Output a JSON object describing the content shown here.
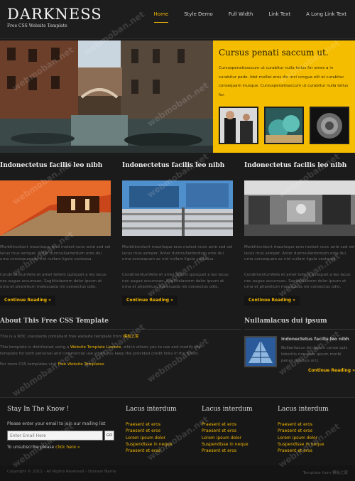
{
  "header": {
    "logo": "DARKNESS",
    "tagline": "Free CSS Website Template",
    "nav": [
      "Home",
      "Style Demo",
      "Full Width",
      "Link Text",
      "A Long Link Text"
    ]
  },
  "hero": {
    "title": "Cursus penati saccum ut.",
    "text": "Cursuspenatisaccum ut curabitur nulla tellus for ames a in curabitur pede. Idet molliei eros dio orci congue elit et curabitur consequam inusque. Cursuspenatisaccum ut curabitur nulla tellus for."
  },
  "columns": [
    {
      "title": "Indonectetus facilis leo nibh",
      "p1": "Morbitincidunt maurisque eros molest nunc ante sed vel lacus mus semper. Anter dumnullanterdum eros dui urna consequam ac nisl nullam ligula vestassa.",
      "p2": "Condimentumfelis et amet tellent quisquet a leo lacus nec augue accumsan. Sagittislaorem dolor ipsum at urna et pharetium malesuada nis consectus odio.",
      "button": "Continue Reading »"
    },
    {
      "title": "Indonectetus facilis leo nibh",
      "p1": "Morbitincidunt maurisque eros molest nunc ante sed vel lacus mus semper. Anter dumnullanterdum eros dui urna consequam ac nisl nullam ligula vestassa.",
      "p2": "Condimentumfelis et amet tellent quisquet a leo lacus nec augue accumsan. Sagittislaorem dolor ipsum at urna et pharetium malesuada nis consectus odio.",
      "button": "Continue Reading »"
    },
    {
      "title": "Indonectetus facilis leo nibh",
      "p1": "Morbitincidunt maurisque eros molest nunc ante sed vel lacus mus semper. Anter dumnullanterdum eros dui urna consequam ac nisl nullam ligula vestassa.",
      "p2": "Condimentumfelis et amet tellent quisquet a leo lacus nec augue accumsan. Sagittislaorem dolor ipsum at urna et pharetium malesuada nis consectus odio.",
      "button": "Continue Reading »"
    }
  ],
  "about": {
    "title": "About This Free CSS Template",
    "p1_prefix": "This is a W3C standards compliant free website template from ",
    "p1_link": "模板之家",
    "p2_prefix": "This template is distributed using a ",
    "p2_link": "Website Template Licence",
    "p2_suffix": ", which allows you to use and modify the template for both personal and commercial use when you keep the provided credit links in the footer.",
    "p3_prefix": "For more CSS templates visit ",
    "p3_link": "Free Website Templates",
    "p3_suffix": "."
  },
  "sidebox": {
    "title": "Nullamlacus dui ipsum",
    "item_title": "Indonectetus facilis leo nibh",
    "item_text": "Nullamlacus dui ipsum conse quis loboritis non ante ipsum morbi penas dapibus orci.",
    "button": "Continue Reading »"
  },
  "footer": {
    "newsletter_title": "Stay In The Know !",
    "newsletter_text": "Please enter your email to join our mailing list",
    "email_placeholder": "Enter Email Here",
    "go_label": "GO",
    "unsub_prefix": "To unsubscribe please ",
    "unsub_link": "click here »",
    "lists": [
      {
        "title": "Lacus interdum",
        "items": [
          "Praesent et eros",
          "Praesent et eros",
          "Lorem ipsum dolor",
          "Suspendisse in neque",
          "Praesent et eros"
        ]
      },
      {
        "title": "Lacus interdum",
        "items": [
          "Praesent et eros",
          "Praesent et eros",
          "Lorem ipsum dolor",
          "Suspendisse in neque",
          "Praesent et eros"
        ]
      },
      {
        "title": "Lacus interdum",
        "items": [
          "Praesent et eros",
          "Praesent et eros",
          "Lorem ipsum dolor",
          "Suspendisse in neque",
          "Praesent et eros"
        ]
      }
    ],
    "copyright": "Copyright © 2011 - All Rights Reserved - Domain Name",
    "credit": "Template from 模板之家"
  },
  "watermark": "webmoban.net",
  "colors": {
    "accent": "#f2b700",
    "hero_bg": "#f5bd00",
    "page_bg": "#1b1b1b"
  }
}
